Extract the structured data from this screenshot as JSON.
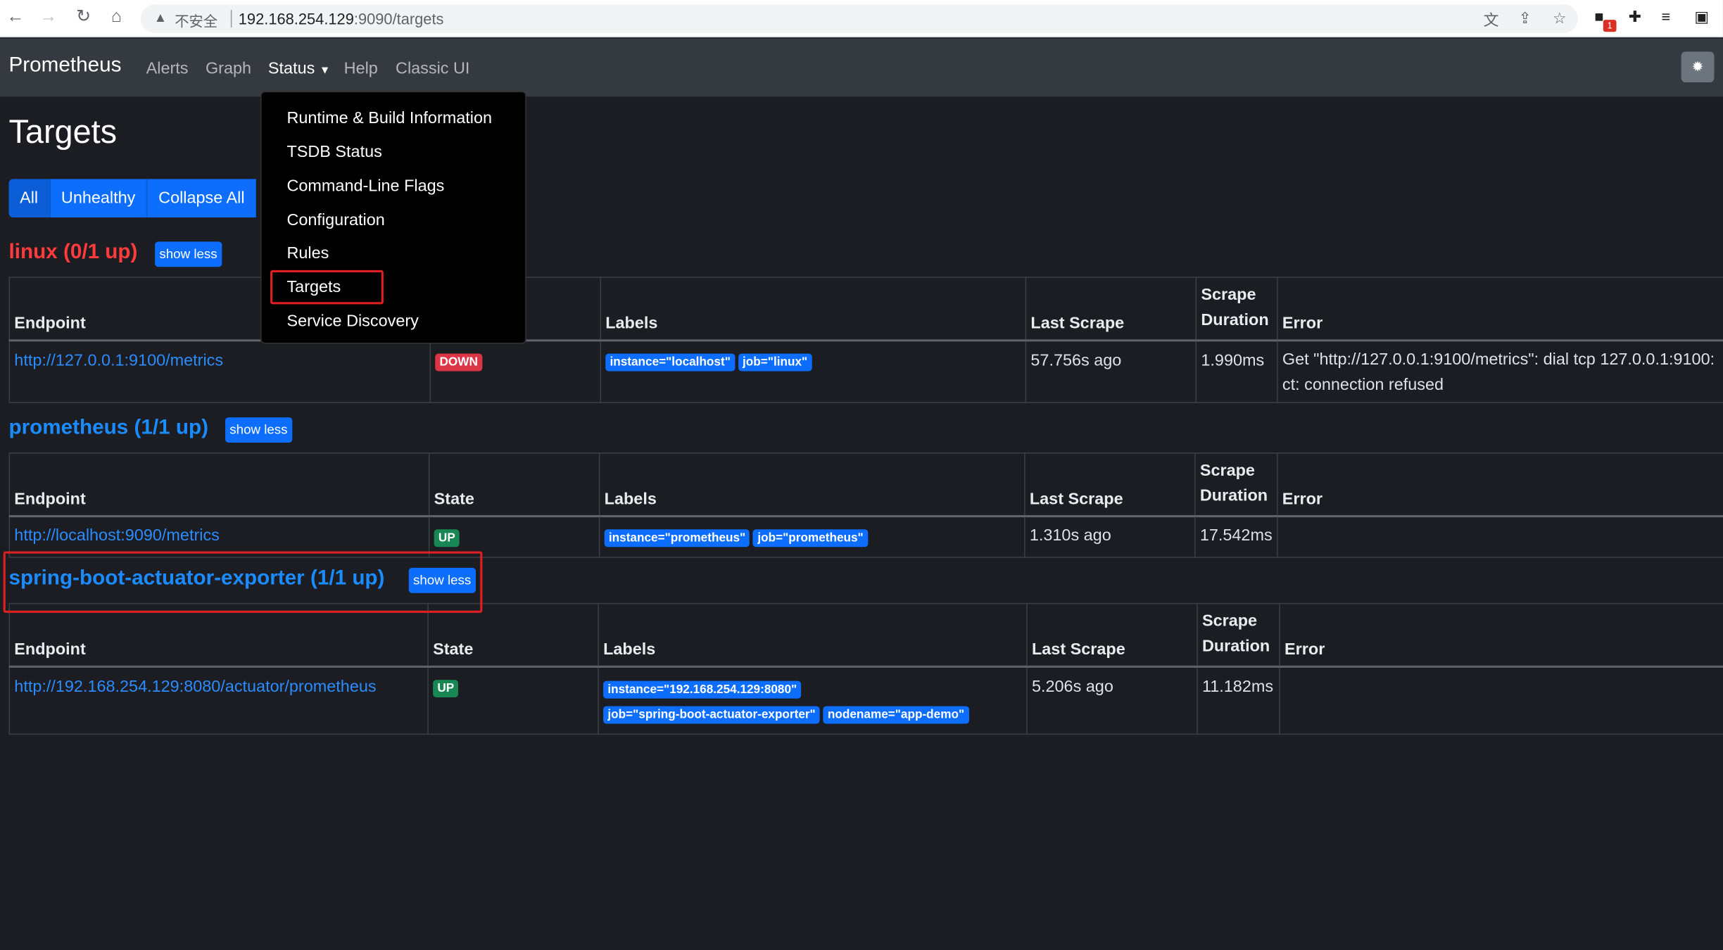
{
  "browser": {
    "insecure_label": "不安全",
    "url_host": "192.168.254.129",
    "url_path": ":9090/targets",
    "ext_badge": "1"
  },
  "navbar": {
    "brand": "Prometheus",
    "links": [
      "Alerts",
      "Graph",
      "Status",
      "Help",
      "Classic UI"
    ]
  },
  "status_menu": {
    "items": [
      "Runtime & Build Information",
      "TSDB Status",
      "Command-Line Flags",
      "Configuration",
      "Rules",
      "Targets",
      "Service Discovery"
    ]
  },
  "page": {
    "title": "Targets",
    "filters": [
      "All",
      "Unhealthy",
      "Collapse All"
    ],
    "show_less": "show less"
  },
  "table_headers": {
    "endpoint": "Endpoint",
    "state": "State",
    "labels": "Labels",
    "last_scrape": "Last Scrape",
    "scrape": "Scrape",
    "duration": "Duration",
    "error": "Error"
  },
  "pools": [
    {
      "title": "linux (0/1 up)",
      "endpoint": "http://127.0.0.1:9100/metrics",
      "state": "DOWN",
      "labels": [
        "instance=\"localhost\"",
        "job=\"linux\""
      ],
      "last_scrape": "57.756s ago",
      "duration": "1.990ms",
      "error_line1": "Get \"http://127.0.0.1:9100/metrics\": dial tcp 127.0.0.1:9100:",
      "error_line2": "ct: connection refused"
    },
    {
      "title": "prometheus (1/1 up)",
      "endpoint": "http://localhost:9090/metrics",
      "state": "UP",
      "labels": [
        "instance=\"prometheus\"",
        "job=\"prometheus\""
      ],
      "last_scrape": "1.310s ago",
      "duration": "17.542ms",
      "error": ""
    },
    {
      "title": "spring-boot-actuator-exporter (1/1 up)",
      "endpoint": "http://192.168.254.129:8080/actuator/prometheus",
      "state": "UP",
      "labels": [
        "instance=\"192.168.254.129:8080\"",
        "job=\"spring-boot-actuator-exporter\"",
        "nodename=\"app-demo\""
      ],
      "last_scrape": "5.206s ago",
      "duration": "11.182ms",
      "error": ""
    }
  ]
}
